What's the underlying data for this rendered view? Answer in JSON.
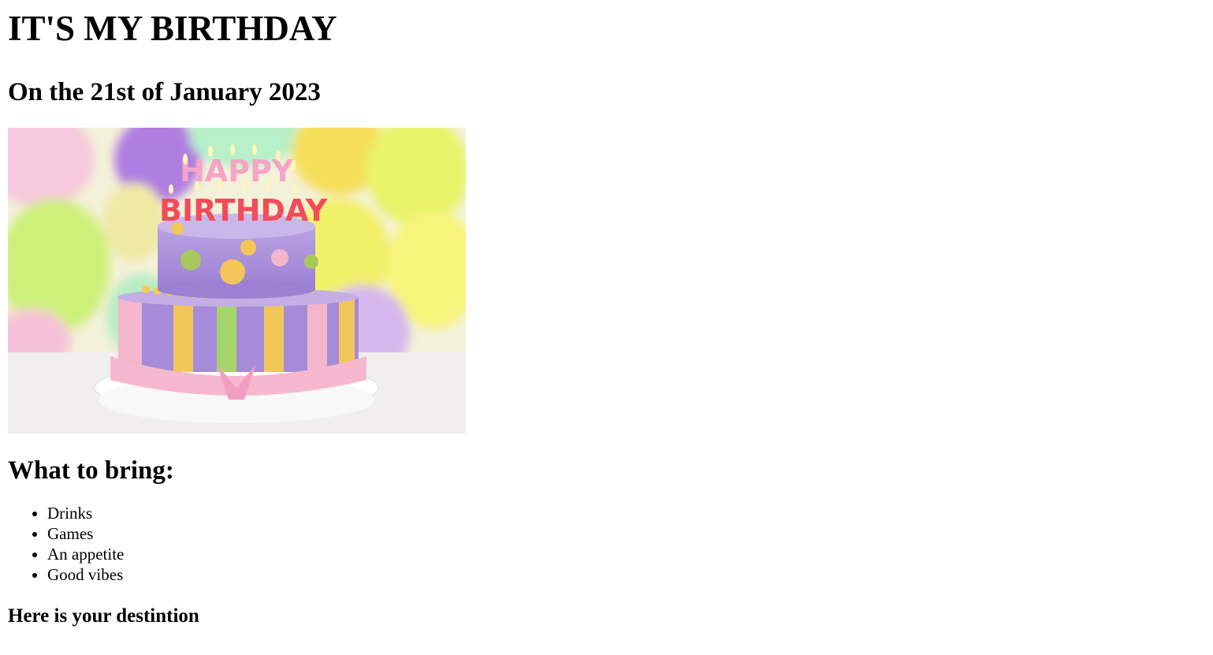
{
  "page": {
    "title": "IT'S MY BIRTHDAY",
    "date_heading": "On the 21st of January 2023",
    "image": {
      "candle_text_line1": "HAPPY",
      "candle_text_line2": "BIRTHDAY"
    },
    "bring_heading": "What to bring:",
    "bring_items": [
      {
        "label": "Drinks"
      },
      {
        "label": "Games"
      },
      {
        "label": "An appetite"
      },
      {
        "label": "Good vibes"
      }
    ],
    "destination_heading": "Here is your destintion"
  },
  "colors": {
    "divider": "#c0605f"
  }
}
